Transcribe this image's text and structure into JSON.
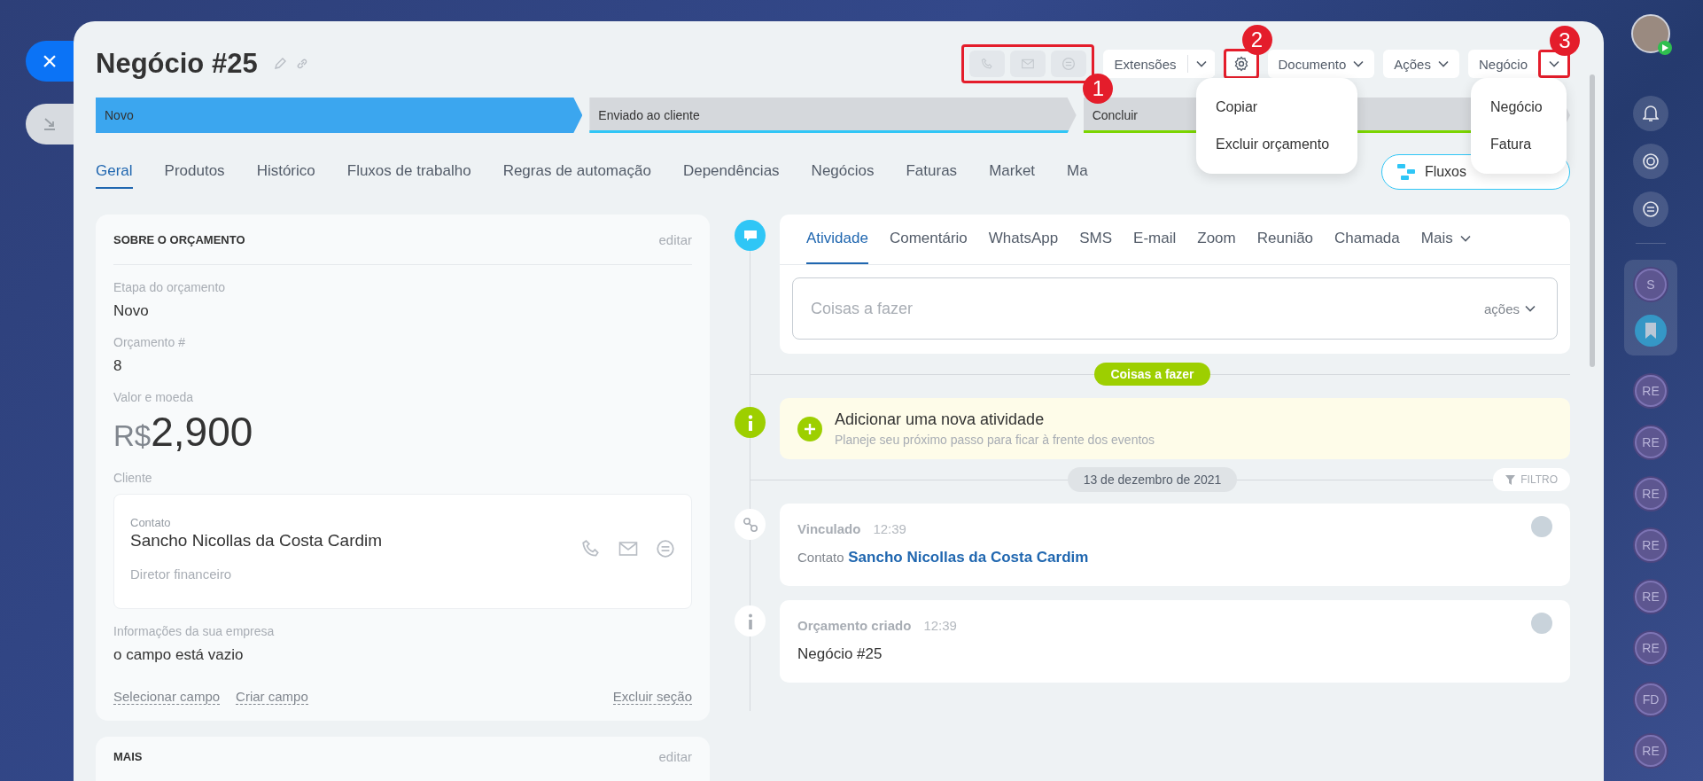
{
  "side_buttons": {
    "close": "×"
  },
  "header": {
    "title": "Negócio #25",
    "extensions": "Extensões",
    "document": "Documento",
    "actions": "Ações",
    "entity": "Negócio",
    "markers": [
      "1",
      "2",
      "3"
    ]
  },
  "settings_menu": {
    "items": [
      "Copiar",
      "Excluir orçamento"
    ]
  },
  "entity_menu": {
    "items": [
      "Negócio",
      "Fatura"
    ]
  },
  "stages": [
    {
      "label": "Novo",
      "selected": true,
      "color": "#3ba6ef"
    },
    {
      "label": "Enviado ao cliente",
      "selected": false,
      "color": "#2fc6f6"
    },
    {
      "label": "Concluir",
      "selected": false,
      "color": "#7bd500"
    }
  ],
  "tabs": [
    {
      "label": "Geral",
      "selected": true
    },
    {
      "label": "Produtos",
      "selected": false
    },
    {
      "label": "Histórico",
      "selected": false
    },
    {
      "label": "Fluxos de trabalho",
      "selected": false
    },
    {
      "label": "Regras de automação",
      "selected": false
    },
    {
      "label": "Dependências",
      "selected": false
    },
    {
      "label": "Negócios",
      "selected": false
    },
    {
      "label": "Faturas",
      "selected": false
    },
    {
      "label": "Market",
      "selected": false
    },
    {
      "label": "Ma",
      "selected": false
    }
  ],
  "flows_button": "Fluxos",
  "about_card": {
    "title": "SOBRE O ORÇAMENTO",
    "edit": "editar",
    "fields": [
      {
        "kind": "text",
        "label": "Etapa do orçamento",
        "value": "Novo"
      },
      {
        "kind": "text",
        "label": "Orçamento #",
        "value": "8"
      },
      {
        "kind": "money",
        "label": "Valor e moeda",
        "currency": "R$",
        "value": "2,900"
      },
      {
        "kind": "client",
        "label": "Cliente",
        "contact_label": "Contato",
        "name": "Sancho Nicollas da Costa Cardim",
        "position": "Diretor financeiro"
      },
      {
        "kind": "text",
        "label": "Informações da sua empresa",
        "value": "o campo está vazio"
      }
    ],
    "links": [
      "Selecionar campo",
      "Criar campo"
    ],
    "delete_link": "Excluir seção"
  },
  "more_card": {
    "title": "MAIS",
    "edit": "editar"
  },
  "composer": {
    "tabs": [
      {
        "label": "Atividade",
        "selected": true
      },
      {
        "label": "Comentário",
        "selected": false
      },
      {
        "label": "WhatsApp",
        "selected": false
      },
      {
        "label": "SMS",
        "selected": false
      },
      {
        "label": "E-mail",
        "selected": false
      },
      {
        "label": "Zoom",
        "selected": false
      },
      {
        "label": "Reunião",
        "selected": false
      },
      {
        "label": "Chamada",
        "selected": false
      },
      {
        "label": "Mais",
        "selected": false
      }
    ],
    "placeholder": "Coisas a fazer",
    "actions": "ações"
  },
  "todo_pill": "Coisas a fazer",
  "add_activity": {
    "title": "Adicionar uma nova atividade",
    "subtitle": "Planeje seu próximo passo para ficar à frente dos eventos"
  },
  "date_label": "13 de dezembro de 2021",
  "filter": "FILTRO",
  "events": [
    {
      "kind": "link",
      "title": "Vinculado",
      "time": "12:39",
      "prefix": "Contato",
      "link": "Sancho Nicollas da Costa Cardim"
    },
    {
      "kind": "info",
      "title": "Orçamento criado",
      "time": "12:39",
      "text": "Negócio #25"
    }
  ],
  "rail": {
    "pinned": "S",
    "chats": [
      "RE",
      "RE",
      "RE",
      "RE",
      "RE",
      "RE",
      "FD",
      "RE"
    ]
  }
}
